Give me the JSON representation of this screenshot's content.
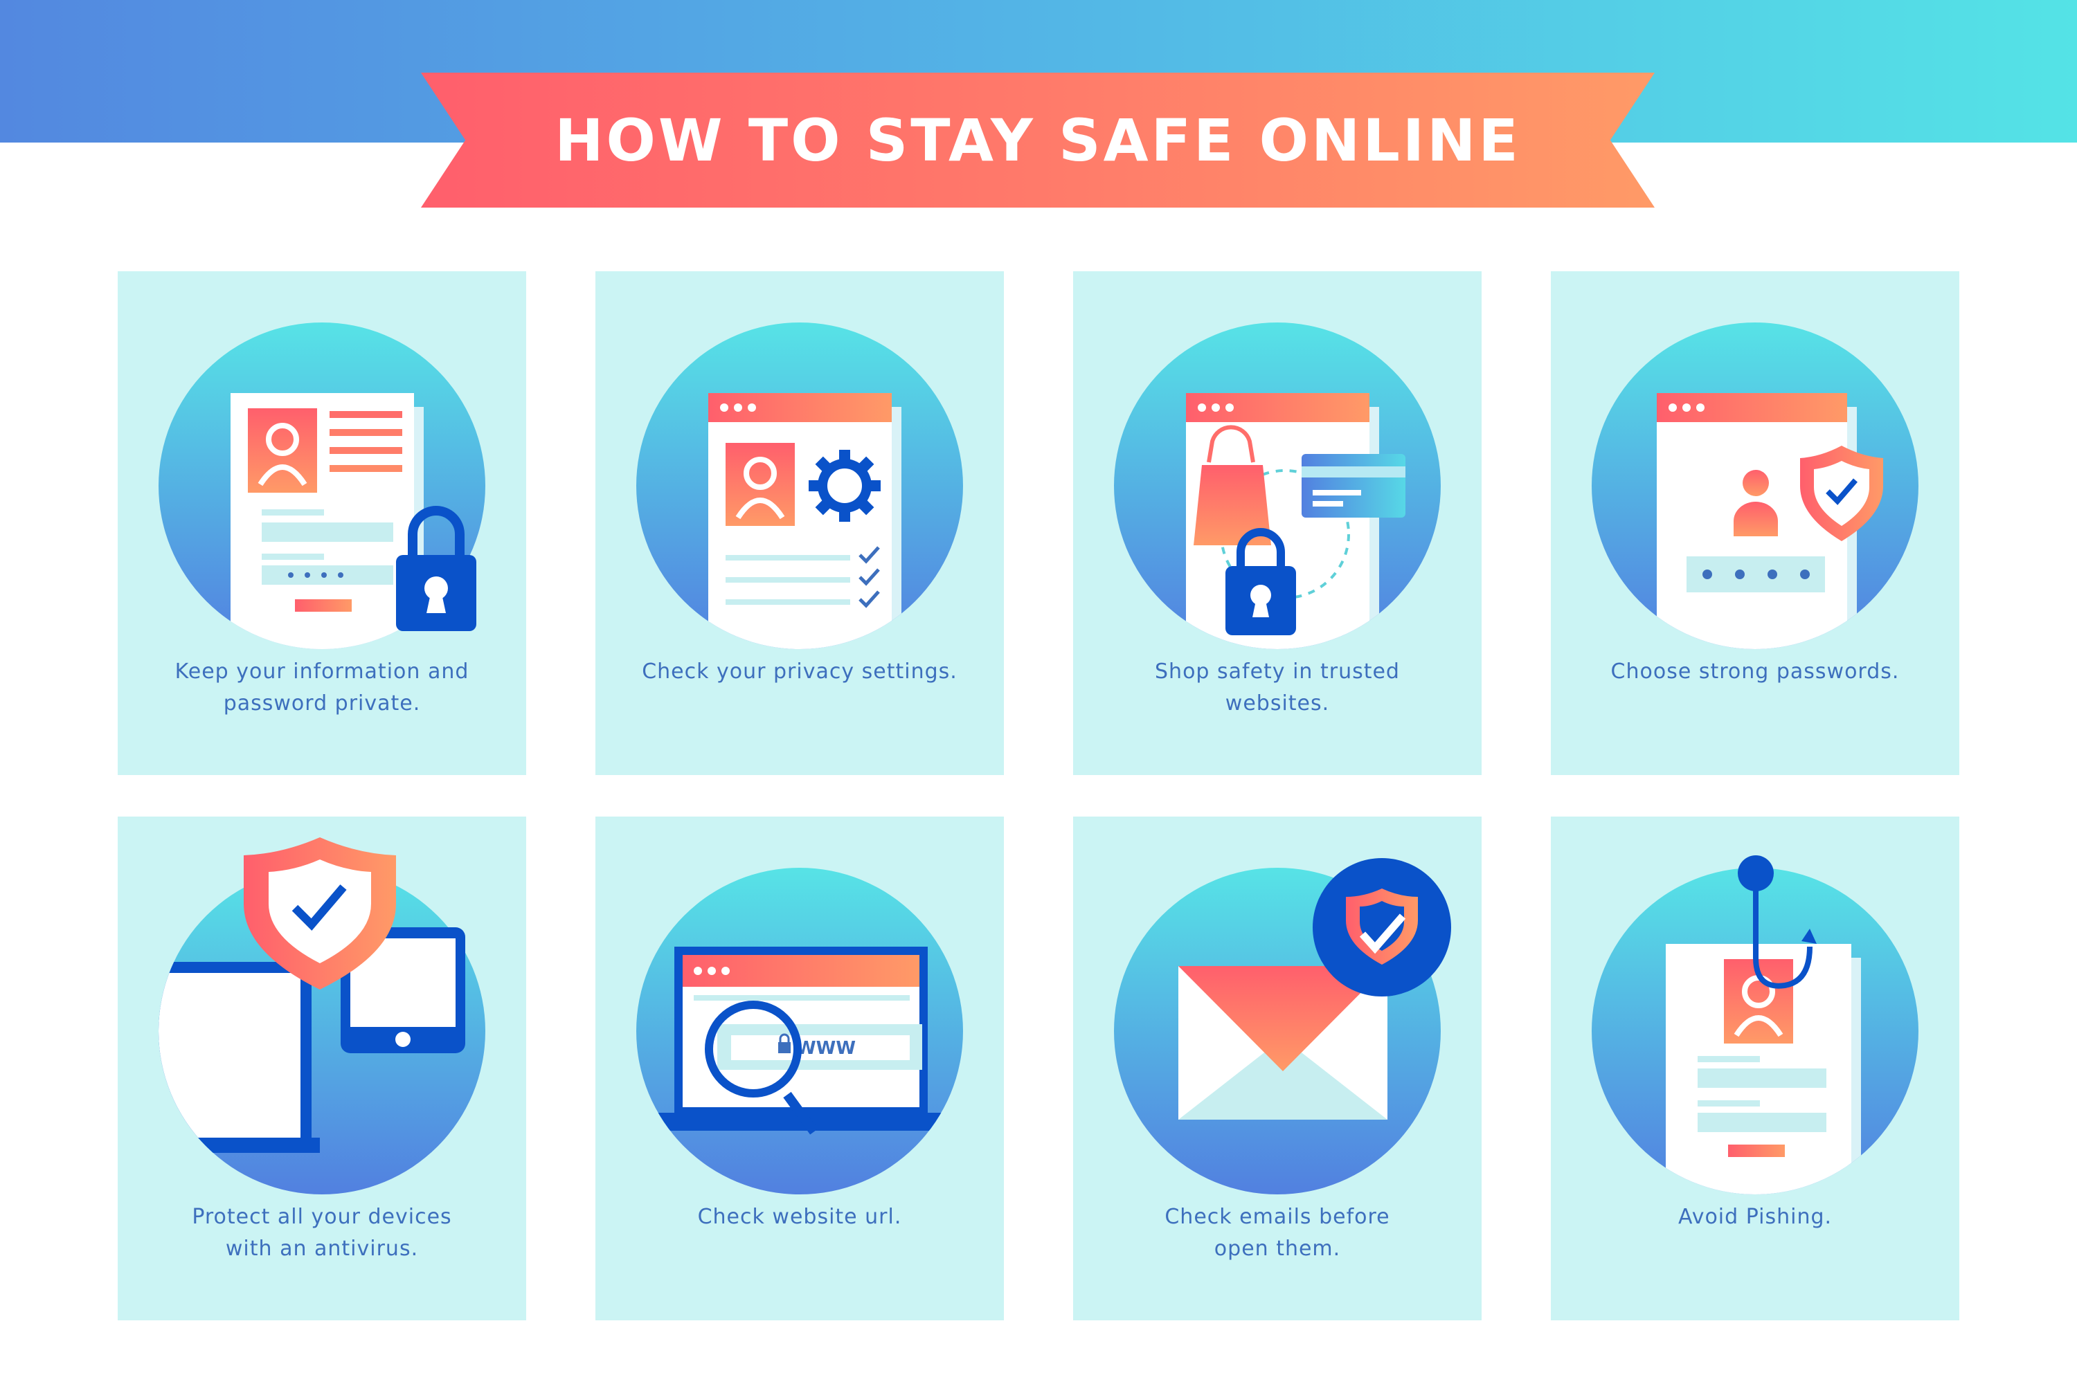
{
  "title": "HOW TO STAY SAFE ONLINE",
  "colors": {
    "band_start": "#5388e0",
    "band_end": "#54e3e6",
    "banner_start": "#ff5f6c",
    "banner_end": "#ff9a67",
    "card_bg": "#cbf4f4",
    "caption_text": "#3d6fbd",
    "accent_blue": "#0a52c9"
  },
  "tips": [
    {
      "line1": "Keep your information and",
      "line2": "password private.",
      "icons": [
        "id-card-icon",
        "padlock-icon"
      ]
    },
    {
      "line1": "Check your privacy settings.",
      "line2": "",
      "icons": [
        "browser-window-icon",
        "gear-icon",
        "checkmark-icon"
      ]
    },
    {
      "line1": "Shop safety in trusted",
      "line2": "websites.",
      "icons": [
        "shopping-bag-icon",
        "credit-card-icon",
        "padlock-icon"
      ]
    },
    {
      "line1": "Choose strong passwords.",
      "line2": "",
      "icons": [
        "user-icon",
        "shield-check-icon",
        "password-field-icon"
      ]
    },
    {
      "line1": "Protect all your devices",
      "line2": "with an antivirus.",
      "icons": [
        "monitor-icon",
        "tablet-icon",
        "shield-check-icon"
      ]
    },
    {
      "line1": "Check website url.",
      "line2": "",
      "icons": [
        "laptop-icon",
        "magnifier-icon",
        "lock-icon"
      ]
    },
    {
      "line1": "Check emails before",
      "line2": "open them.",
      "icons": [
        "envelope-icon",
        "shield-check-icon"
      ]
    },
    {
      "line1": "Avoid Pishing.",
      "line2": "",
      "icons": [
        "fishing-hook-icon",
        "id-card-icon"
      ]
    }
  ],
  "url_text": "WWW"
}
